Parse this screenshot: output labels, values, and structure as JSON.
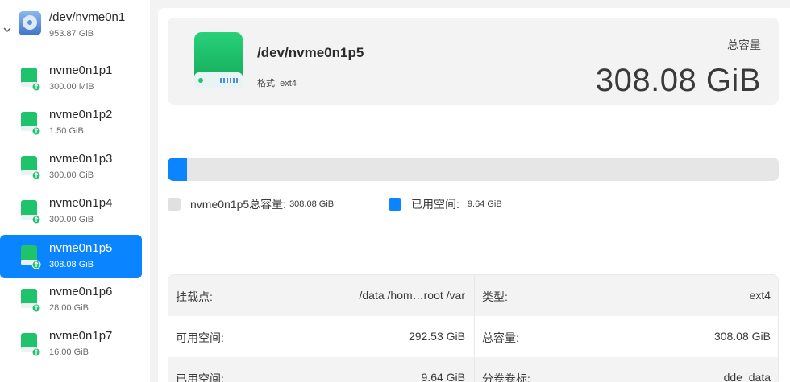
{
  "sidebar": {
    "disk": {
      "name": "/dev/nvme0n1",
      "size": "953.87 GiB"
    },
    "partitions": [
      {
        "name": "nvme0n1p1",
        "size": "300.00 MiB"
      },
      {
        "name": "nvme0n1p2",
        "size": "1.50 GiB"
      },
      {
        "name": "nvme0n1p3",
        "size": "300.00 GiB"
      },
      {
        "name": "nvme0n1p4",
        "size": "300.00 GiB"
      },
      {
        "name": "nvme0n1p5",
        "size": "308.08 GiB"
      },
      {
        "name": "nvme0n1p6",
        "size": "28.00 GiB"
      },
      {
        "name": "nvme0n1p7",
        "size": "16.00 GiB"
      }
    ],
    "selected_index": 4
  },
  "header": {
    "device": "/dev/nvme0n1p5",
    "format": "格式: ext4",
    "capacity_label": "总容量",
    "capacity_value": "308.08 GiB"
  },
  "usage": {
    "used_fraction": 0.0313,
    "total_label": "nvme0n1p5总容量:",
    "total_value": "308.08 GiB",
    "used_label": "已用空间:",
    "used_value": "9.64 GiB"
  },
  "info": {
    "mount_label": "挂载点:",
    "mount_value": "/data /hom…root /var",
    "type_label": "类型:",
    "type_value": "ext4",
    "free_label": "可用空间:",
    "free_value": "292.53 GiB",
    "total_label": "总容量:",
    "total_value": "308.08 GiB",
    "used_label": "已用空间:",
    "used_value": "9.64 GiB",
    "volume_label": "分卷卷标:",
    "volume_value": "_dde_data"
  },
  "colors": {
    "accent": "#0a84ff",
    "disk_green": "#1ec36b",
    "bar_bg": "#e6e6e6",
    "total_swatch": "#e0e0e0"
  }
}
